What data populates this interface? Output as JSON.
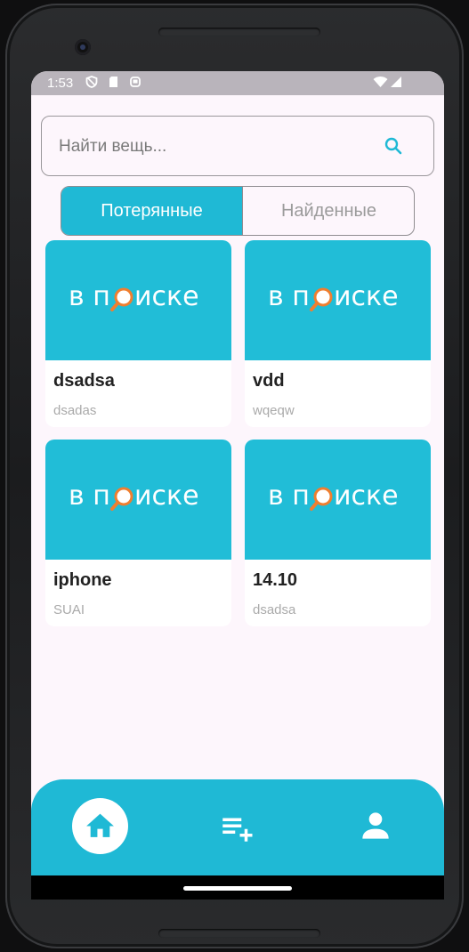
{
  "statusbar": {
    "time": "1:53"
  },
  "search": {
    "placeholder": "Найти вещь..."
  },
  "tabs": [
    {
      "label": "Потерянные",
      "active": true
    },
    {
      "label": "Найденные",
      "active": false
    }
  ],
  "items": [
    {
      "logo_text": "в поиске",
      "title": "dsadsa",
      "subtitle": "dsadas"
    },
    {
      "logo_text": "в поиске",
      "title": "vdd",
      "subtitle": "wqeqw"
    },
    {
      "logo_text": "в поиске",
      "title": "iphone",
      "subtitle": "SUAI"
    },
    {
      "logo_text": "в поиске",
      "title": "14.10",
      "subtitle": "dsadsa"
    }
  ],
  "bottom_nav": {
    "items": [
      {
        "icon": "home-icon",
        "active": true
      },
      {
        "icon": "playlist-add-icon",
        "active": false
      },
      {
        "icon": "person-icon",
        "active": false
      }
    ]
  },
  "colors": {
    "accent": "#1fb9d5",
    "background": "#fdf6fc",
    "logo_ring": "#f07e2f"
  }
}
